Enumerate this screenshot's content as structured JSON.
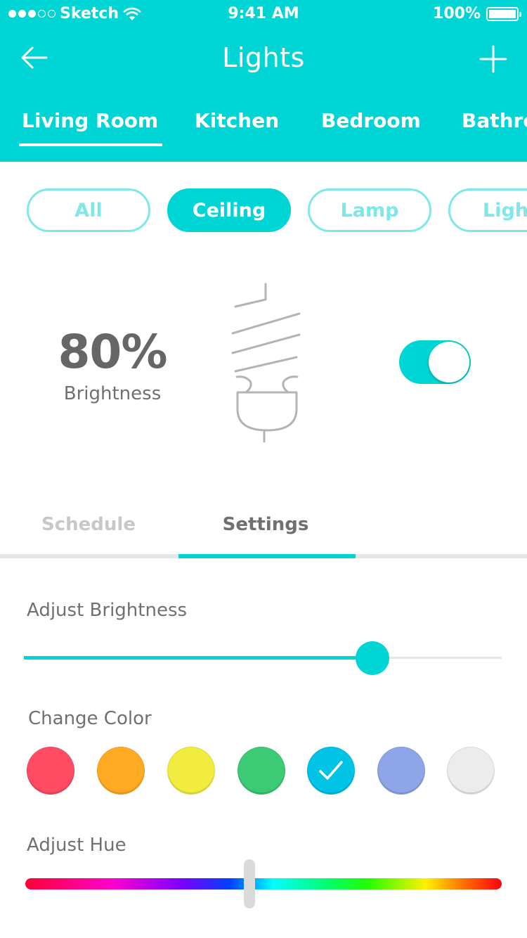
{
  "status_bar": {
    "carrier": "Sketch",
    "time": "9:41 AM",
    "battery": "100%"
  },
  "nav": {
    "title": "Lights",
    "back_icon": "arrow-left-icon",
    "add_icon": "plus-icon"
  },
  "rooms": {
    "items": [
      "Living Room",
      "Kitchen",
      "Bedroom",
      "Bathroom"
    ],
    "active_index": 0
  },
  "filters": {
    "items": [
      "All",
      "Ceiling",
      "Lamp",
      "Light"
    ],
    "active_index": 1
  },
  "light": {
    "brightness_value": "80%",
    "brightness_label": "Brightness",
    "power_on": true,
    "bulb_icon": "light-bulb-icon"
  },
  "section_tabs": {
    "items": [
      "Schedule",
      "Settings"
    ],
    "active_index": 1
  },
  "settings": {
    "adjust_brightness_label": "Adjust Brightness",
    "brightness_slider_value": 0.73,
    "change_color_label": "Change Color",
    "colors": [
      "#ff4c63",
      "#ffaa22",
      "#f1ec3f",
      "#3dca74",
      "#00c3e6",
      "#8ea5e8",
      "#ececec"
    ],
    "selected_color_index": 4,
    "adjust_hue_label": "Adjust Hue",
    "hue_slider_value": 0.47
  },
  "theme": {
    "accent": "#00d5d5",
    "text_muted": "#707070"
  }
}
